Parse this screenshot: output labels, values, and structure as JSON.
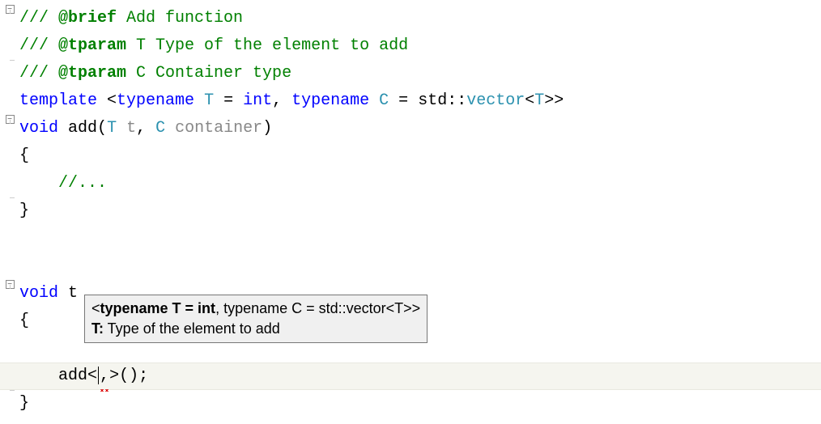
{
  "code": {
    "doc1_prefix": "/// ",
    "doc1_tag": "@brief",
    "doc1_text": " Add function",
    "doc2_prefix": "/// ",
    "doc2_tag": "@tparam",
    "doc2_text": " T Type of the element to add",
    "doc3_prefix": "/// ",
    "doc3_tag": "@tparam",
    "doc3_text": " C Container type",
    "tmpl_kw1": "template",
    "tmpl_lt": " <",
    "tmpl_kw2": "typename",
    "tmpl_sp1": " ",
    "tmpl_T": "T",
    "tmpl_eq1": " = ",
    "tmpl_int": "int",
    "tmpl_comma": ", ",
    "tmpl_kw3": "typename",
    "tmpl_sp2": " ",
    "tmpl_C": "C",
    "tmpl_eq2": " = ",
    "tmpl_std": "std",
    "tmpl_cc": "::",
    "tmpl_vector": "vector",
    "tmpl_ltT": "<",
    "tmpl_T2": "T",
    "tmpl_gtgt": ">>",
    "fn_void": "void",
    "fn_sp": " ",
    "fn_name": "add",
    "fn_open": "(",
    "fn_Ttype": "T",
    "fn_sp2": " ",
    "fn_t": "t",
    "fn_comma": ", ",
    "fn_Ctype": "C",
    "fn_sp3": " ",
    "fn_container": "container",
    "fn_close": ")",
    "brace_open": "{",
    "body_indent": "    ",
    "body_comment": "//...",
    "brace_close": "}",
    "fn2_void": "void",
    "fn2_sp": " ",
    "fn2_name": "t",
    "fn2_brace_open": "{",
    "call_indent": "    ",
    "call_name": "add",
    "call_lt": "<",
    "call_comma": ",",
    "call_gt": ">",
    "call_parens": "();",
    "fn2_brace_close": "}"
  },
  "tooltip": {
    "sig_lt": "<",
    "sig_bold": "typename T = int",
    "sig_rest": ", typename C = std::vector<T>>",
    "param_label": "T:",
    "param_desc": " Type of the element to add"
  },
  "fold": {
    "minus": "−"
  }
}
